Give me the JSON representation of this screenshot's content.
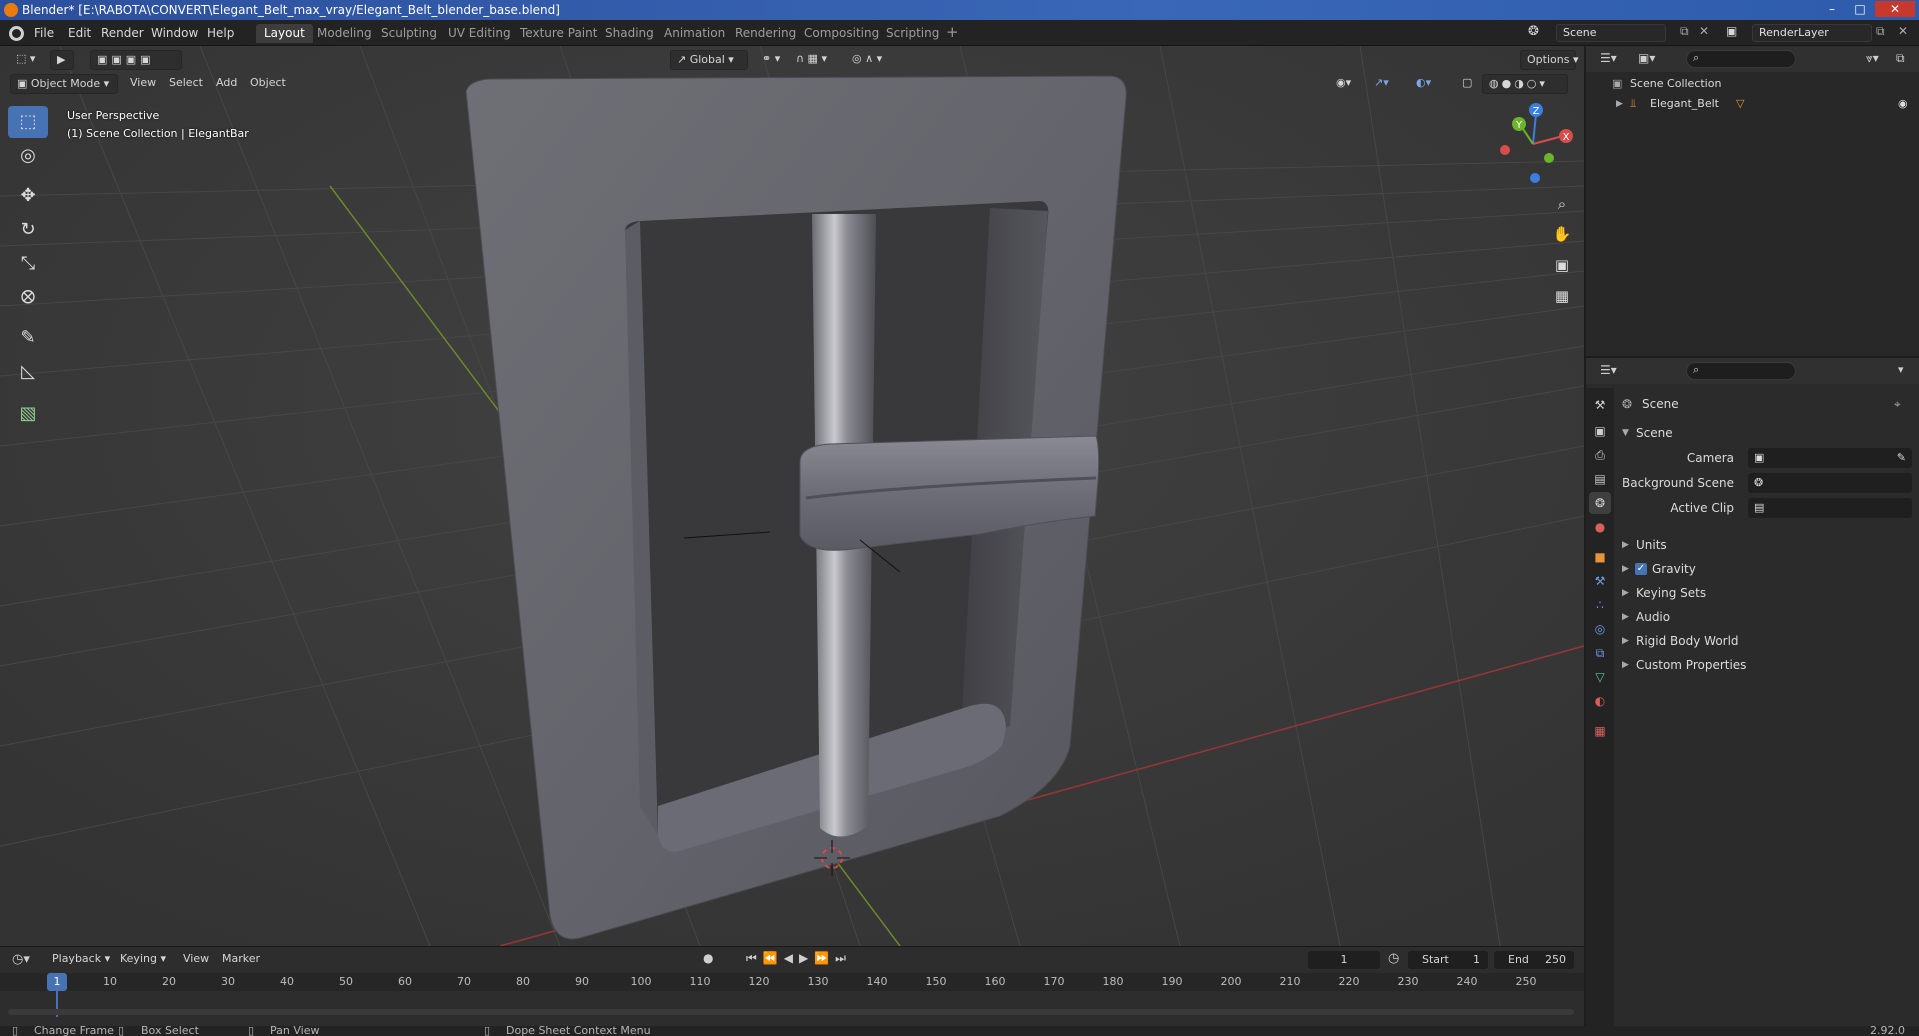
{
  "titlebar": {
    "title": "Blender* [E:\\RABOTA\\CONVERT\\Elegant_Belt_max_vray/Elegant_Belt_blender_base.blend]"
  },
  "menu": {
    "items": [
      "File",
      "Edit",
      "Render",
      "Window",
      "Help"
    ]
  },
  "workspaces": [
    "Layout",
    "Modeling",
    "Sculpting",
    "UV Editing",
    "Texture Paint",
    "Shading",
    "Animation",
    "Rendering",
    "Compositing",
    "Scripting"
  ],
  "active_workspace": "Layout",
  "scene_field": "Scene",
  "renderlayer_field": "RenderLayer",
  "viewport": {
    "mode": "Object Mode",
    "menus": [
      "View",
      "Select",
      "Add",
      "Object"
    ],
    "transform_orientation": "Global",
    "options_label": "Options",
    "perspective_label": "User Perspective",
    "collection_label": "(1) Scene Collection | ElegantBar",
    "axes": {
      "x": "X",
      "y": "Y",
      "z": "Z"
    }
  },
  "outliner": {
    "rows": [
      {
        "label": "Scene Collection"
      },
      {
        "label": "Elegant_Belt"
      }
    ]
  },
  "properties": {
    "breadcrumb": "Scene",
    "section": "Scene",
    "fields": [
      {
        "label": "Camera"
      },
      {
        "label": "Background Scene"
      },
      {
        "label": "Active Clip"
      }
    ],
    "panels": [
      "Units",
      "Gravity",
      "Keying Sets",
      "Audio",
      "Rigid Body World",
      "Custom Properties"
    ],
    "gravity_checked": true
  },
  "timeline": {
    "menus": [
      "Playback",
      "Keying",
      "View",
      "Marker"
    ],
    "current_frame": "1",
    "start_label": "Start",
    "start_value": "1",
    "end_label": "End",
    "end_value": "250",
    "ruler": [
      "1",
      "10",
      "20",
      "30",
      "40",
      "50",
      "60",
      "70",
      "80",
      "90",
      "100",
      "110",
      "120",
      "130",
      "140",
      "150",
      "160",
      "170",
      "180",
      "190",
      "200",
      "210",
      "220",
      "230",
      "240",
      "250"
    ]
  },
  "statusbar": {
    "items": [
      "Change Frame",
      "Box Select",
      "Pan View",
      "Dope Sheet Context Menu"
    ],
    "version": "2.92.0"
  }
}
